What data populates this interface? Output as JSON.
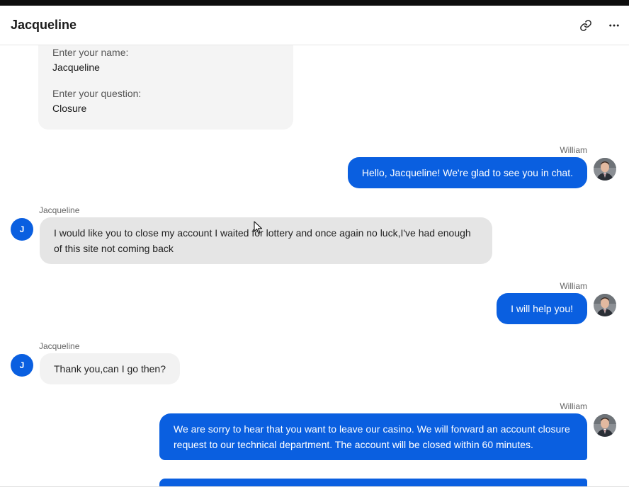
{
  "header": {
    "title": "Jacqueline",
    "link_icon": "link-icon",
    "more_icon": "more-horizontal-icon"
  },
  "form": {
    "name_label": "Enter your name:",
    "name_value": "Jacqueline",
    "question_label": "Enter your question:",
    "question_value": "Closure"
  },
  "messages": [
    {
      "sender": "William",
      "role": "agent",
      "text": "Hello, Jacqueline! We're glad to see you in chat."
    },
    {
      "sender": "Jacqueline",
      "role": "user",
      "avatar_initial": "J",
      "text": "I would like you to close my account I waited for lottery and once again no luck,I've had enough of this site not coming back"
    },
    {
      "sender": "William",
      "role": "agent",
      "text": "I will help you!"
    },
    {
      "sender": "Jacqueline",
      "role": "user",
      "avatar_initial": "J",
      "text": "Thank you,can I go then?"
    },
    {
      "sender": "William",
      "role": "agent",
      "text": "We are sorry to hear that you want to leave our casino. We will forward an account closure request to our technical department. The account will be closed within 60 minutes."
    }
  ],
  "colors": {
    "agent_bubble": "#0a5fe0",
    "user_bubble": "#e5e5e5",
    "user_avatar": "#0a5fe0"
  }
}
